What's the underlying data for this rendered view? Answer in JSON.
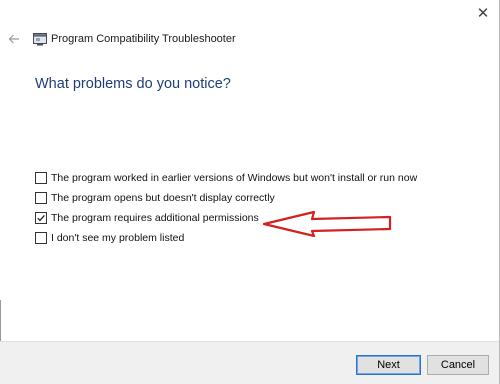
{
  "window": {
    "title": "Program Compatibility Troubleshooter",
    "close_glyph": "✕",
    "accent_color": "#1f3d79"
  },
  "page": {
    "heading": "What problems do you notice?"
  },
  "options": [
    {
      "label": "The program worked in earlier versions of Windows but won't install or run now",
      "checked": false
    },
    {
      "label": "The program opens but doesn't display correctly",
      "checked": false
    },
    {
      "label": "The program requires additional permissions",
      "checked": true
    },
    {
      "label": "I don't see my problem listed",
      "checked": false
    }
  ],
  "annotation": {
    "icon": "red-arrow-left-icon",
    "color": "#d42020"
  },
  "footer": {
    "next_label": "Next",
    "cancel_label": "Cancel"
  }
}
